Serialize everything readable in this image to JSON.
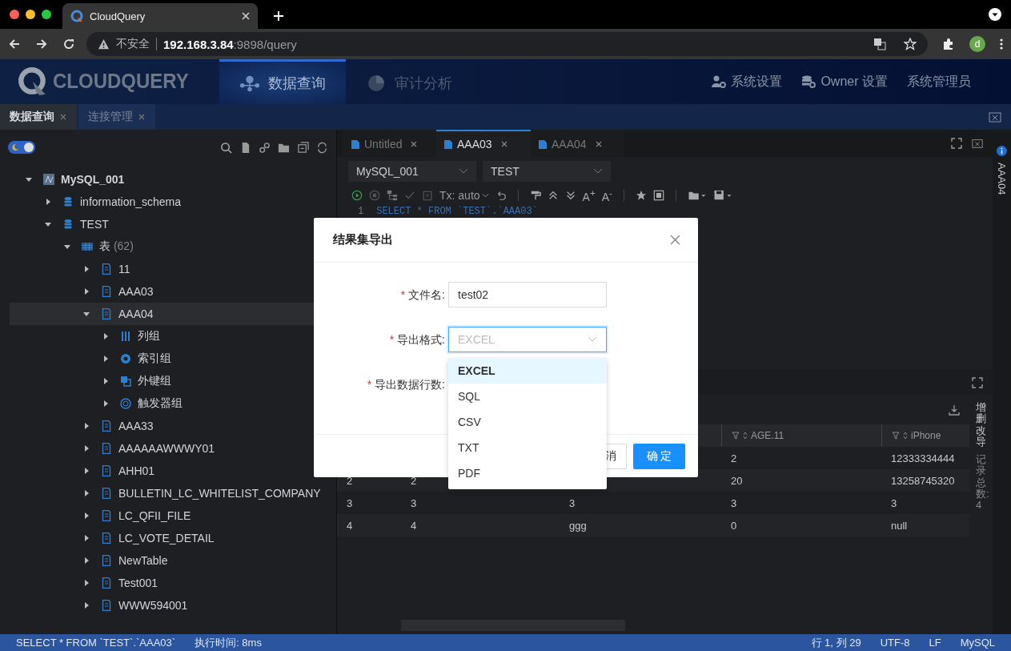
{
  "browser": {
    "tab_title": "CloudQuery",
    "security": "不安全",
    "url_host": "192.168.3.84",
    "url_rest": ":9898/query",
    "avatar": "d"
  },
  "header": {
    "logo": "CLOUDQUERY",
    "nav": [
      {
        "label": "数据查询",
        "kind": "query",
        "selected": true
      },
      {
        "label": "审计分析",
        "kind": "audit",
        "selected": false
      }
    ],
    "actions": [
      {
        "label": "系统设置",
        "kind": "user-gear"
      },
      {
        "label": "Owner 设置",
        "kind": "db-gear"
      },
      {
        "label": "系统管理员",
        "kind": "text"
      }
    ]
  },
  "theme_toggle": {
    "on": true
  },
  "page_tabs": [
    {
      "label": "数据查询",
      "selected": true
    },
    {
      "label": "连接管理",
      "selected": false
    }
  ],
  "tree": [
    {
      "label": "MySQL_001",
      "kind": "connection",
      "expanded": true,
      "selected": false,
      "children": [
        {
          "label": "information_schema",
          "kind": "database",
          "expanded": false,
          "selected": false
        },
        {
          "label": "TEST",
          "kind": "database",
          "expanded": true,
          "selected": false,
          "children": [
            {
              "label": "表",
              "count": "(62)",
              "kind": "tablegroup",
              "expanded": true,
              "selected": false,
              "children": [
                {
                  "label": "11",
                  "kind": "table",
                  "expanded": false,
                  "selected": false
                },
                {
                  "label": "AAA03",
                  "kind": "table",
                  "expanded": false,
                  "selected": false
                },
                {
                  "label": "AAA04",
                  "kind": "table",
                  "expanded": true,
                  "selected": true,
                  "children": [
                    {
                      "label": "列组",
                      "kind": "columns",
                      "expanded": false,
                      "selected": false
                    },
                    {
                      "label": "索引组",
                      "kind": "index",
                      "expanded": false,
                      "selected": false
                    },
                    {
                      "label": "外键组",
                      "kind": "foreignkey",
                      "expanded": false,
                      "selected": false
                    },
                    {
                      "label": "触发器组",
                      "kind": "trigger",
                      "expanded": false,
                      "selected": false
                    }
                  ]
                },
                {
                  "label": "AAA33",
                  "kind": "table",
                  "expanded": false,
                  "selected": false
                },
                {
                  "label": "AAAAAAWWWY01",
                  "kind": "table",
                  "expanded": false,
                  "selected": false
                },
                {
                  "label": "AHH01",
                  "kind": "table",
                  "expanded": false,
                  "selected": false
                },
                {
                  "label": "BULLETIN_LC_WHITELIST_COMPANY",
                  "kind": "table",
                  "expanded": false,
                  "selected": false
                },
                {
                  "label": "LC_QFII_FILE",
                  "kind": "table",
                  "expanded": false,
                  "selected": false
                },
                {
                  "label": "LC_VOTE_DETAIL",
                  "kind": "table",
                  "expanded": false,
                  "selected": false
                },
                {
                  "label": "NewTable",
                  "kind": "table",
                  "expanded": false,
                  "selected": false
                },
                {
                  "label": "Test001",
                  "kind": "table",
                  "expanded": false,
                  "selected": false
                },
                {
                  "label": "WWW594001",
                  "kind": "table",
                  "expanded": false,
                  "selected": false
                }
              ]
            }
          ]
        }
      ]
    }
  ],
  "editor": {
    "tabs": [
      {
        "label": "Untitled",
        "selected": false
      },
      {
        "label": "AAA03",
        "selected": true
      },
      {
        "label": "AAA04",
        "selected": false
      }
    ],
    "connection": "MySQL_001",
    "database": "TEST",
    "tx_mode": "Tx: auto",
    "font_buttons": [
      "A$^{+}$",
      "A$^{-}$"
    ],
    "line_number": "1",
    "code": "SELECT * FROM `TEST`.`AAA03`",
    "side_label": "AAA04"
  },
  "results": {
    "columns": [
      {
        "label": "AGE.11"
      },
      {
        "label": "iPhone"
      }
    ],
    "rows": [
      {
        "c4": "2",
        "c5": "12333334444"
      },
      {
        "c1": "2",
        "c2": "2",
        "c4": "20",
        "c5": "13258745320"
      },
      {
        "c1": "3",
        "c2": "3",
        "c3": "3",
        "c4": "3",
        "c5": "3"
      },
      {
        "c1": "4",
        "c2": "4",
        "c3": "ggg",
        "c4": "0",
        "c5": "null"
      }
    ],
    "side_actions": "增删改导",
    "record_count": "记录总数: 4"
  },
  "dialog": {
    "title": "结果集导出",
    "fields": [
      {
        "label": "文件名:",
        "required_mark": "*",
        "kind": "input",
        "value": "test02"
      },
      {
        "label": "导出格式:",
        "required_mark": "*",
        "kind": "select",
        "value": "EXCEL"
      },
      {
        "label": "导出数据行数:",
        "required_mark": "*",
        "kind": "hidden-field"
      }
    ],
    "options": [
      {
        "label": "EXCEL",
        "selected": true
      },
      {
        "label": "SQL",
        "selected": false
      },
      {
        "label": "CSV",
        "selected": false
      },
      {
        "label": "TXT",
        "selected": false
      },
      {
        "label": "PDF",
        "selected": false
      }
    ],
    "cancel": "消",
    "ok": "确 定"
  },
  "status_bar": {
    "left": [
      "SELECT * FROM `TEST`.`AAA03`",
      "执行时间: 8ms"
    ],
    "right": [
      "行 1, 列 29",
      "UTF-8",
      "LF",
      "MySQL"
    ]
  }
}
